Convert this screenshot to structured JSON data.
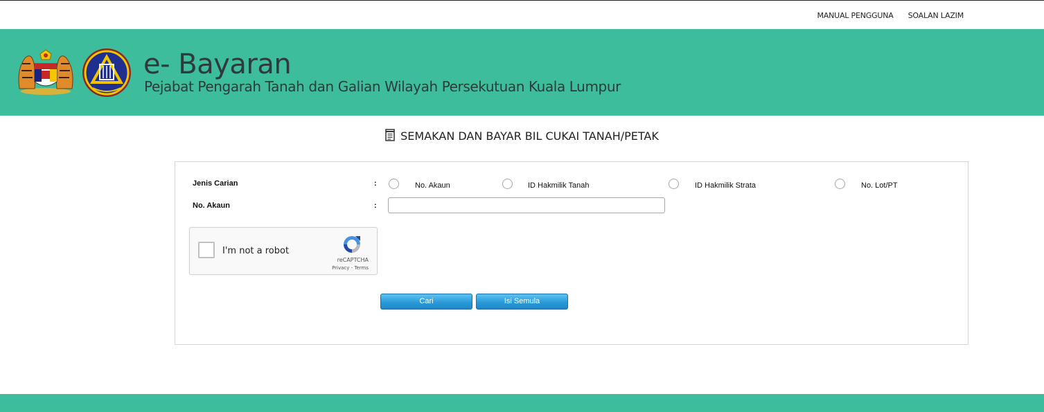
{
  "topnav": {
    "manual": "MANUAL PENGGUNA",
    "faq": "SOALAN LAZIM"
  },
  "header": {
    "title": "e- Bayaran",
    "subtitle": "Pejabat Pengarah Tanah dan Galian Wilayah Persekutuan Kuala Lumpur"
  },
  "page": {
    "heading": "SEMAKAN DAN BAYAR BIL CUKAI TANAH/PETAK",
    "heading_icon": "document-icon"
  },
  "form": {
    "search_type_label": "Jenis Carian",
    "colon": ":",
    "search_types": [
      {
        "label": "No. Akaun",
        "selected": false
      },
      {
        "label": "ID Hakmilik Tanah",
        "selected": false
      },
      {
        "label": "ID Hakmilik Strata",
        "selected": false
      },
      {
        "label": "No. Lot/PT",
        "selected": false
      }
    ],
    "account_label": "No. Akaun",
    "account_value": ""
  },
  "captcha": {
    "text": "I'm not a robot",
    "brand": "reCAPTCHA",
    "links": "Privacy - Terms"
  },
  "buttons": {
    "search": "Cari",
    "reset": "Isi Semula"
  },
  "colors": {
    "accent": "#3dbd9b",
    "button": "#2a9bd8"
  }
}
